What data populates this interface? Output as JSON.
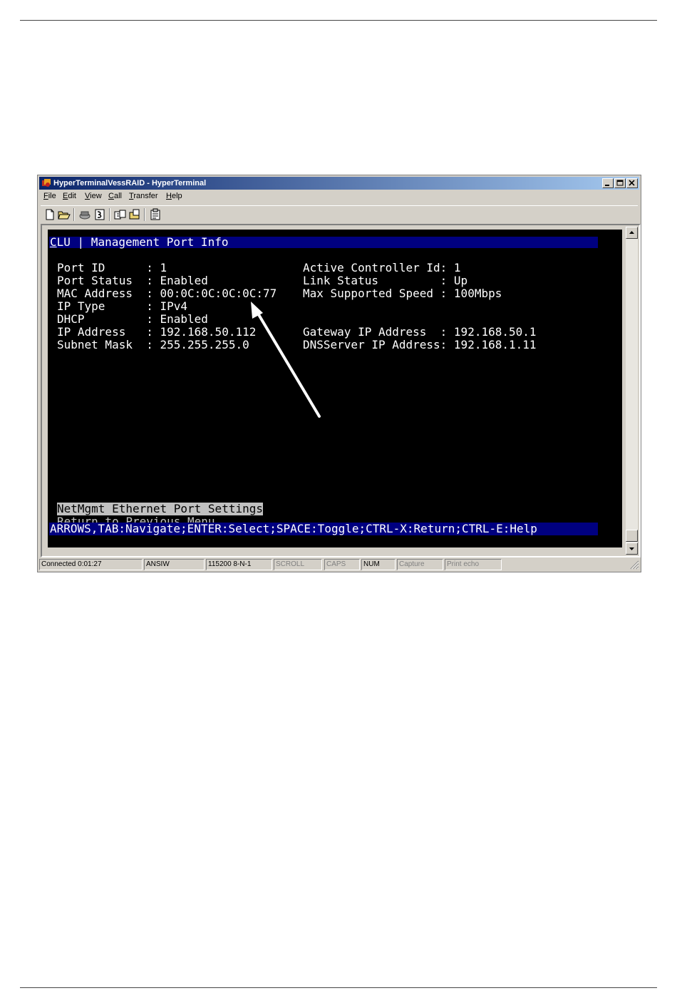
{
  "window": {
    "title": "HyperTerminalVessRAID - HyperTerminal",
    "menu": [
      {
        "label": "File",
        "access_key": "F",
        "rest": "ile"
      },
      {
        "label": "Edit",
        "access_key": "E",
        "rest": "dit"
      },
      {
        "label": "View",
        "access_key": "V",
        "rest": "iew"
      },
      {
        "label": "Call",
        "access_key": "C",
        "rest": "all"
      },
      {
        "label": "Transfer",
        "access_key": "T",
        "rest": "ransfer"
      },
      {
        "label": "Help",
        "access_key": "H",
        "rest": "elp"
      }
    ],
    "toolbar_icons": [
      "new-icon",
      "open-icon",
      "call-icon",
      "disconnect-icon",
      "send-icon",
      "receive-icon",
      "properties-icon"
    ]
  },
  "terminal": {
    "header_prefix": "C",
    "header_rest": "LU | Management Port Info",
    "rows": [
      {
        "left": "Port ID      : 1",
        "right": "Active Controller Id: 1"
      },
      {
        "left": "Port Status  : Enabled",
        "right": "Link Status         : Up"
      },
      {
        "left": "MAC Address  : 00:0C:0C:0C:0C:77",
        "right": "Max Supported Speed : 100Mbps"
      },
      {
        "left": "IP Type      : IPv4",
        "right": ""
      },
      {
        "left": "DHCP         : Enabled",
        "right": ""
      },
      {
        "left": "IP Address   : 192.168.50.112",
        "right": "Gateway IP Address  : 192.168.50.1"
      },
      {
        "left": "Subnet Mask  : 255.255.255.0",
        "right": "DNSServer IP Address: 192.168.1.11"
      }
    ],
    "menu_items": [
      "NetMgmt Ethernet Port Settings",
      "Return to Previous Menu"
    ],
    "footer": "ARROWS,TAB:Navigate;ENTER:Select;SPACE:Toggle;CTRL-X:Return;CTRL-E:Help"
  },
  "status": [
    "Connected 0:01:27",
    "ANSIW",
    "115200 8-N-1",
    "SCROLL",
    "CAPS",
    "NUM",
    "Capture",
    "Print echo"
  ],
  "colors": {
    "terminal_bg": "#000000",
    "terminal_text": "#ffffff",
    "highlight_bar": "#000080",
    "selected_item": "#c0c0c0",
    "title_gradient_start": "#0a246a"
  }
}
